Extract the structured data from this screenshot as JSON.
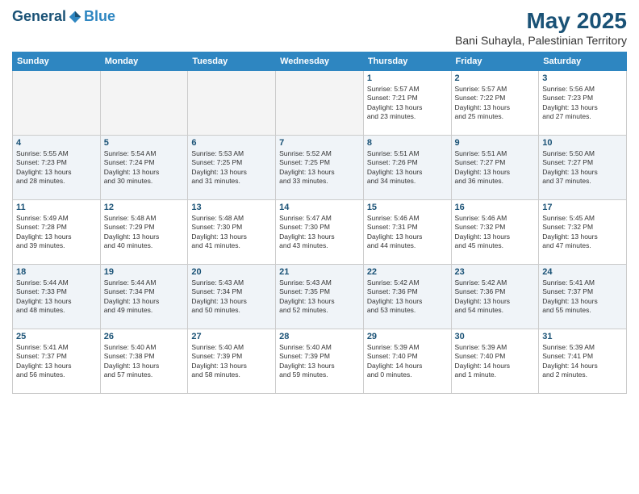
{
  "logo": {
    "general": "General",
    "blue": "Blue"
  },
  "calendar": {
    "title": "May 2025",
    "location": "Bani Suhayla, Palestinian Territory",
    "days": [
      "Sunday",
      "Monday",
      "Tuesday",
      "Wednesday",
      "Thursday",
      "Friday",
      "Saturday"
    ],
    "weeks": [
      [
        {
          "day": "",
          "info": ""
        },
        {
          "day": "",
          "info": ""
        },
        {
          "day": "",
          "info": ""
        },
        {
          "day": "",
          "info": ""
        },
        {
          "day": "1",
          "info": "Sunrise: 5:57 AM\nSunset: 7:21 PM\nDaylight: 13 hours\nand 23 minutes."
        },
        {
          "day": "2",
          "info": "Sunrise: 5:57 AM\nSunset: 7:22 PM\nDaylight: 13 hours\nand 25 minutes."
        },
        {
          "day": "3",
          "info": "Sunrise: 5:56 AM\nSunset: 7:23 PM\nDaylight: 13 hours\nand 27 minutes."
        }
      ],
      [
        {
          "day": "4",
          "info": "Sunrise: 5:55 AM\nSunset: 7:23 PM\nDaylight: 13 hours\nand 28 minutes."
        },
        {
          "day": "5",
          "info": "Sunrise: 5:54 AM\nSunset: 7:24 PM\nDaylight: 13 hours\nand 30 minutes."
        },
        {
          "day": "6",
          "info": "Sunrise: 5:53 AM\nSunset: 7:25 PM\nDaylight: 13 hours\nand 31 minutes."
        },
        {
          "day": "7",
          "info": "Sunrise: 5:52 AM\nSunset: 7:25 PM\nDaylight: 13 hours\nand 33 minutes."
        },
        {
          "day": "8",
          "info": "Sunrise: 5:51 AM\nSunset: 7:26 PM\nDaylight: 13 hours\nand 34 minutes."
        },
        {
          "day": "9",
          "info": "Sunrise: 5:51 AM\nSunset: 7:27 PM\nDaylight: 13 hours\nand 36 minutes."
        },
        {
          "day": "10",
          "info": "Sunrise: 5:50 AM\nSunset: 7:27 PM\nDaylight: 13 hours\nand 37 minutes."
        }
      ],
      [
        {
          "day": "11",
          "info": "Sunrise: 5:49 AM\nSunset: 7:28 PM\nDaylight: 13 hours\nand 39 minutes."
        },
        {
          "day": "12",
          "info": "Sunrise: 5:48 AM\nSunset: 7:29 PM\nDaylight: 13 hours\nand 40 minutes."
        },
        {
          "day": "13",
          "info": "Sunrise: 5:48 AM\nSunset: 7:30 PM\nDaylight: 13 hours\nand 41 minutes."
        },
        {
          "day": "14",
          "info": "Sunrise: 5:47 AM\nSunset: 7:30 PM\nDaylight: 13 hours\nand 43 minutes."
        },
        {
          "day": "15",
          "info": "Sunrise: 5:46 AM\nSunset: 7:31 PM\nDaylight: 13 hours\nand 44 minutes."
        },
        {
          "day": "16",
          "info": "Sunrise: 5:46 AM\nSunset: 7:32 PM\nDaylight: 13 hours\nand 45 minutes."
        },
        {
          "day": "17",
          "info": "Sunrise: 5:45 AM\nSunset: 7:32 PM\nDaylight: 13 hours\nand 47 minutes."
        }
      ],
      [
        {
          "day": "18",
          "info": "Sunrise: 5:44 AM\nSunset: 7:33 PM\nDaylight: 13 hours\nand 48 minutes."
        },
        {
          "day": "19",
          "info": "Sunrise: 5:44 AM\nSunset: 7:34 PM\nDaylight: 13 hours\nand 49 minutes."
        },
        {
          "day": "20",
          "info": "Sunrise: 5:43 AM\nSunset: 7:34 PM\nDaylight: 13 hours\nand 50 minutes."
        },
        {
          "day": "21",
          "info": "Sunrise: 5:43 AM\nSunset: 7:35 PM\nDaylight: 13 hours\nand 52 minutes."
        },
        {
          "day": "22",
          "info": "Sunrise: 5:42 AM\nSunset: 7:36 PM\nDaylight: 13 hours\nand 53 minutes."
        },
        {
          "day": "23",
          "info": "Sunrise: 5:42 AM\nSunset: 7:36 PM\nDaylight: 13 hours\nand 54 minutes."
        },
        {
          "day": "24",
          "info": "Sunrise: 5:41 AM\nSunset: 7:37 PM\nDaylight: 13 hours\nand 55 minutes."
        }
      ],
      [
        {
          "day": "25",
          "info": "Sunrise: 5:41 AM\nSunset: 7:37 PM\nDaylight: 13 hours\nand 56 minutes."
        },
        {
          "day": "26",
          "info": "Sunrise: 5:40 AM\nSunset: 7:38 PM\nDaylight: 13 hours\nand 57 minutes."
        },
        {
          "day": "27",
          "info": "Sunrise: 5:40 AM\nSunset: 7:39 PM\nDaylight: 13 hours\nand 58 minutes."
        },
        {
          "day": "28",
          "info": "Sunrise: 5:40 AM\nSunset: 7:39 PM\nDaylight: 13 hours\nand 59 minutes."
        },
        {
          "day": "29",
          "info": "Sunrise: 5:39 AM\nSunset: 7:40 PM\nDaylight: 14 hours\nand 0 minutes."
        },
        {
          "day": "30",
          "info": "Sunrise: 5:39 AM\nSunset: 7:40 PM\nDaylight: 14 hours\nand 1 minute."
        },
        {
          "day": "31",
          "info": "Sunrise: 5:39 AM\nSunset: 7:41 PM\nDaylight: 14 hours\nand 2 minutes."
        }
      ]
    ]
  }
}
